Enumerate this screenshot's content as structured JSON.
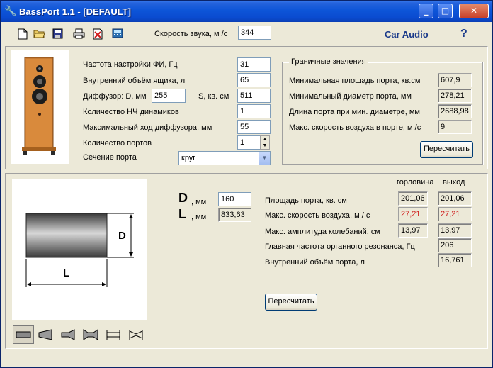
{
  "window": {
    "title": "BassPort 1.1 - [DEFAULT]"
  },
  "toolbar": {
    "icons": [
      "new-file-icon",
      "open-folder-icon",
      "save-icon",
      "print-icon",
      "delete-icon",
      "calculator-icon"
    ],
    "speed_label": "Скорость звука, м /с",
    "speed_value": "344",
    "brand": "Car Audio",
    "help": "?"
  },
  "params": {
    "freq_label": "Частота настройки ФИ, Гц",
    "freq_value": "31",
    "volume_label": "Внутренний объём ящика, л",
    "volume_value": "65",
    "diffuser_label": "Диффузор: D, мм",
    "diffuser_d_value": "255",
    "s_label": "S, кв. см",
    "s_value": "511",
    "count_label": "Количество НЧ динамиков",
    "count_value": "1",
    "stroke_label": "Максимальный ход диффузора, мм",
    "stroke_value": "55",
    "ports_label": "Количество портов",
    "ports_value": "1",
    "section_label": "Сечение порта",
    "section_value": "круг"
  },
  "limits": {
    "title": "Граничные значения",
    "rows": [
      {
        "label": "Минимальная площадь порта, кв.см",
        "value": "607,9"
      },
      {
        "label": "Минимальный диаметр порта, мм",
        "value": "278,21"
      },
      {
        "label": "Длина порта при мин. диаметре, мм",
        "value": "2688,98"
      },
      {
        "label": "Макс. скорость воздуха в порте, м /с",
        "value": "9"
      }
    ],
    "recalc": "Пересчитать"
  },
  "port": {
    "d_letter": "D",
    "l_letter": "L",
    "unit_mm": ", мм",
    "d_value": "160",
    "l_value": "833,63",
    "diagram_d": "D",
    "diagram_l": "L",
    "col_throat": "горловина",
    "col_exit": "выход",
    "area_label": "Площадь порта, кв. см",
    "area_throat": "201,06",
    "area_exit": "201,06",
    "speed_label": "Макс. скорость воздуха, м / с",
    "speed_throat": "27,21",
    "speed_exit": "27,21",
    "ampl_label": "Макс. амплитуда колебаний, см",
    "ampl_throat": "13,97",
    "ampl_exit": "13,97",
    "organ_label": "Главная частота органного резонанса, Гц",
    "organ_value": "206",
    "inner_label": "Внутренний объём порта, л",
    "inner_value": "16,761",
    "recalc": "Пересчитать"
  },
  "colors": {
    "accent_red": "#d01818",
    "brand_blue": "#1a3a8a"
  }
}
